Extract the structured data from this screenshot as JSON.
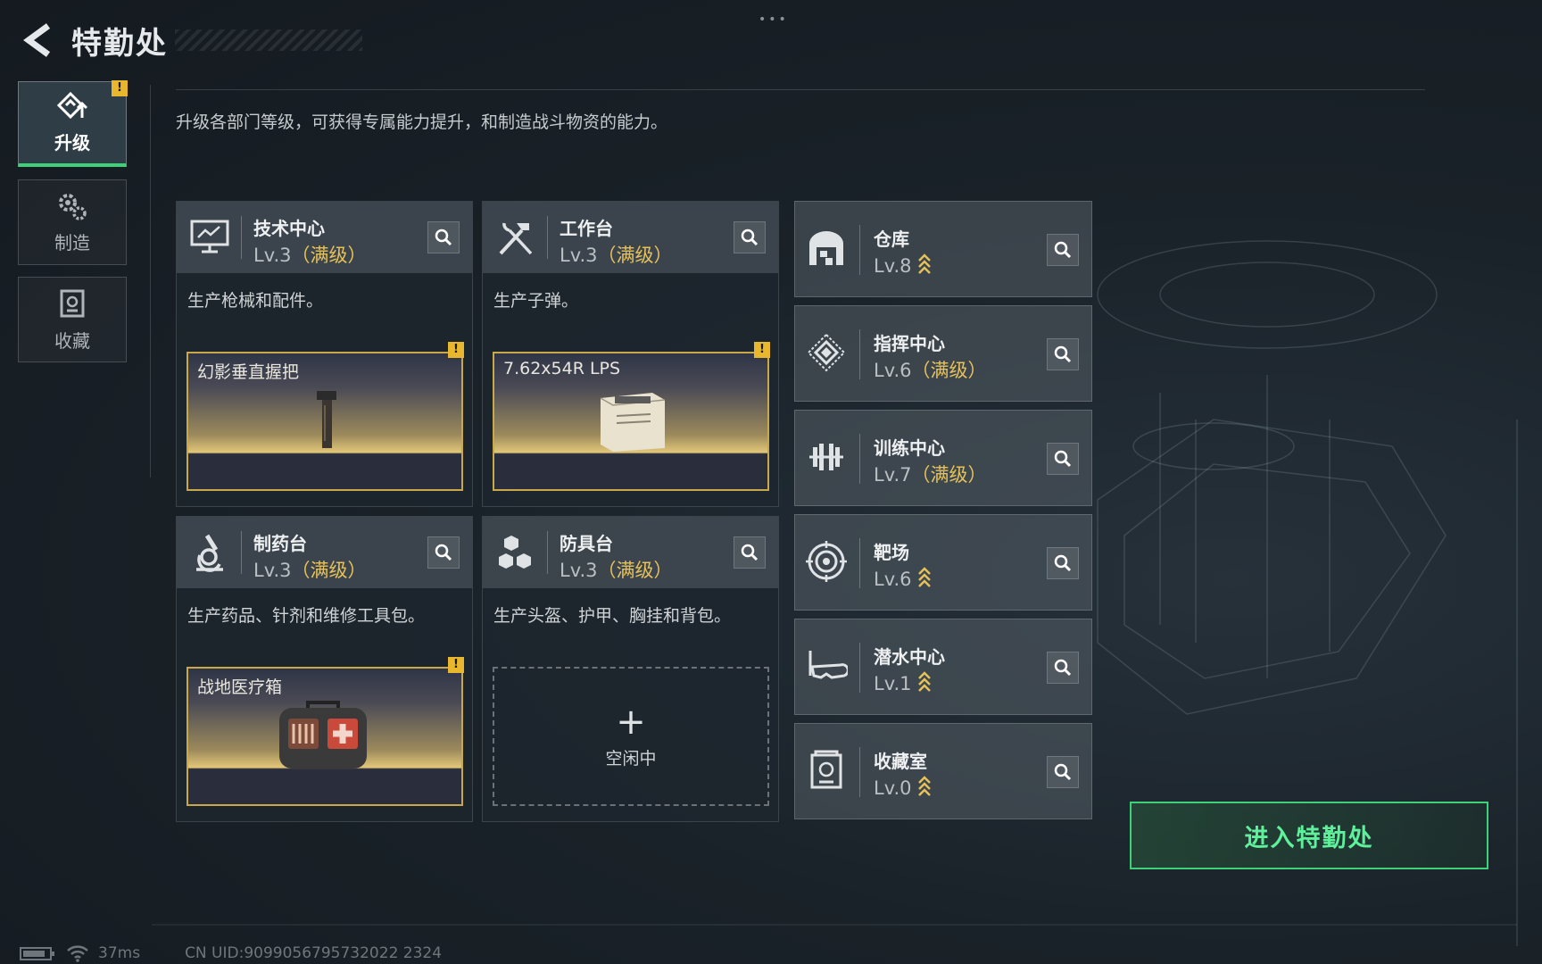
{
  "header": {
    "title": "特勤处"
  },
  "nav": [
    {
      "label": "升级",
      "icon": "upgrade-icon",
      "active": true,
      "badge": "!"
    },
    {
      "label": "制造",
      "icon": "gears-icon",
      "active": false
    },
    {
      "label": "收藏",
      "icon": "collection-icon",
      "active": false
    }
  ],
  "description": "升级各部门等级，可获得专属能力提升，和制造战斗物资的能力。",
  "departments": [
    {
      "name": "技术中心",
      "level": "Lv.3",
      "max": "（满级）",
      "desc": "生产枪械和配件。",
      "product": "幻影垂直握把",
      "badge": "!"
    },
    {
      "name": "工作台",
      "level": "Lv.3",
      "max": "（满级）",
      "desc": "生产子弹。",
      "product": "7.62x54R LPS",
      "badge": "!"
    },
    {
      "name": "制药台",
      "level": "Lv.3",
      "max": "（满级）",
      "desc": "生产药品、针剂和维修工具包。",
      "product": "战地医疗箱",
      "badge": "!"
    },
    {
      "name": "防具台",
      "level": "Lv.3",
      "max": "（满级）",
      "desc": "生产头盔、护甲、胸挂和背包。",
      "idle_label": "空闲中"
    }
  ],
  "facilities": [
    {
      "name": "仓库",
      "level": "Lv.8",
      "max": "",
      "icon": "warehouse-icon",
      "upgradable": true
    },
    {
      "name": "指挥中心",
      "level": "Lv.6",
      "max": "（满级）",
      "icon": "command-icon",
      "upgradable": false
    },
    {
      "name": "训练中心",
      "level": "Lv.7",
      "max": "（满级）",
      "icon": "dumbbell-icon",
      "upgradable": false
    },
    {
      "name": "靶场",
      "level": "Lv.6",
      "max": "",
      "icon": "target-icon",
      "upgradable": true
    },
    {
      "name": "潜水中心",
      "level": "Lv.1",
      "max": "",
      "icon": "diving-mask-icon",
      "upgradable": true
    },
    {
      "name": "收藏室",
      "level": "Lv.0",
      "max": "",
      "icon": "collection-room-icon",
      "upgradable": true
    }
  ],
  "enter_button": "进入特勤处",
  "status": {
    "ping": "37ms",
    "uid": "CN UID:9099056795732022 2324"
  },
  "colors": {
    "accent_green": "#3ed17a",
    "gold": "#e6c15a",
    "badge": "#e9b72e"
  }
}
